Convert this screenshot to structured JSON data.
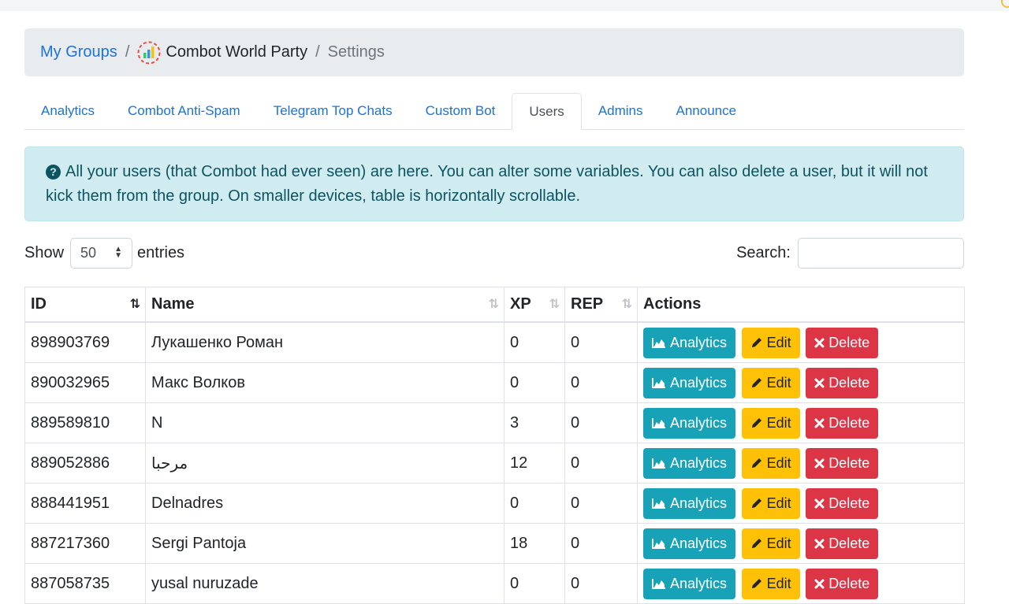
{
  "breadcrumb": {
    "home": "My Groups",
    "group": "Combot World Party",
    "current": "Settings",
    "separator": "/"
  },
  "tabs": [
    {
      "label": "Analytics",
      "active": false
    },
    {
      "label": "Combot Anti-Spam",
      "active": false
    },
    {
      "label": "Telegram Top Chats",
      "active": false
    },
    {
      "label": "Custom Bot",
      "active": false
    },
    {
      "label": "Users",
      "active": true
    },
    {
      "label": "Admins",
      "active": false
    },
    {
      "label": "Announce",
      "active": false
    }
  ],
  "alert": {
    "icon": "question-circle-icon",
    "text": "All your users (that Combot had ever seen) are here. You can alter some variables. You can also delete a user, but it will not kick them from the group. On smaller devices, table is horizontally scrollable."
  },
  "controls": {
    "show_label": "Show",
    "entries_value": "50",
    "entries_label": "entries",
    "search_label": "Search:",
    "search_value": ""
  },
  "table": {
    "headers": {
      "id": "ID",
      "name": "Name",
      "xp": "XP",
      "rep": "REP",
      "actions": "Actions"
    },
    "rows": [
      {
        "id": "898903769",
        "name": "Лукашенко Роман",
        "xp": "0",
        "rep": "0"
      },
      {
        "id": "890032965",
        "name": "Макс Волков",
        "xp": "0",
        "rep": "0"
      },
      {
        "id": "889589810",
        "name": "N",
        "xp": "3",
        "rep": "0"
      },
      {
        "id": "889052886",
        "name": "مرحبا",
        "xp": "12",
        "rep": "0"
      },
      {
        "id": "888441951",
        "name": "Delnadres",
        "xp": "0",
        "rep": "0"
      },
      {
        "id": "887217360",
        "name": "Sergi Pantoja",
        "xp": "18",
        "rep": "0"
      },
      {
        "id": "887058735",
        "name": "yusal nuruzade",
        "xp": "0",
        "rep": "0"
      }
    ],
    "buttons": {
      "analytics": "Analytics",
      "edit": "Edit",
      "delete": "Delete"
    }
  },
  "colors": {
    "link": "#1a73d9",
    "analytics": "#17a2b8",
    "edit": "#ffc107",
    "delete": "#dc3545",
    "alert_bg": "#d1ecf1"
  }
}
